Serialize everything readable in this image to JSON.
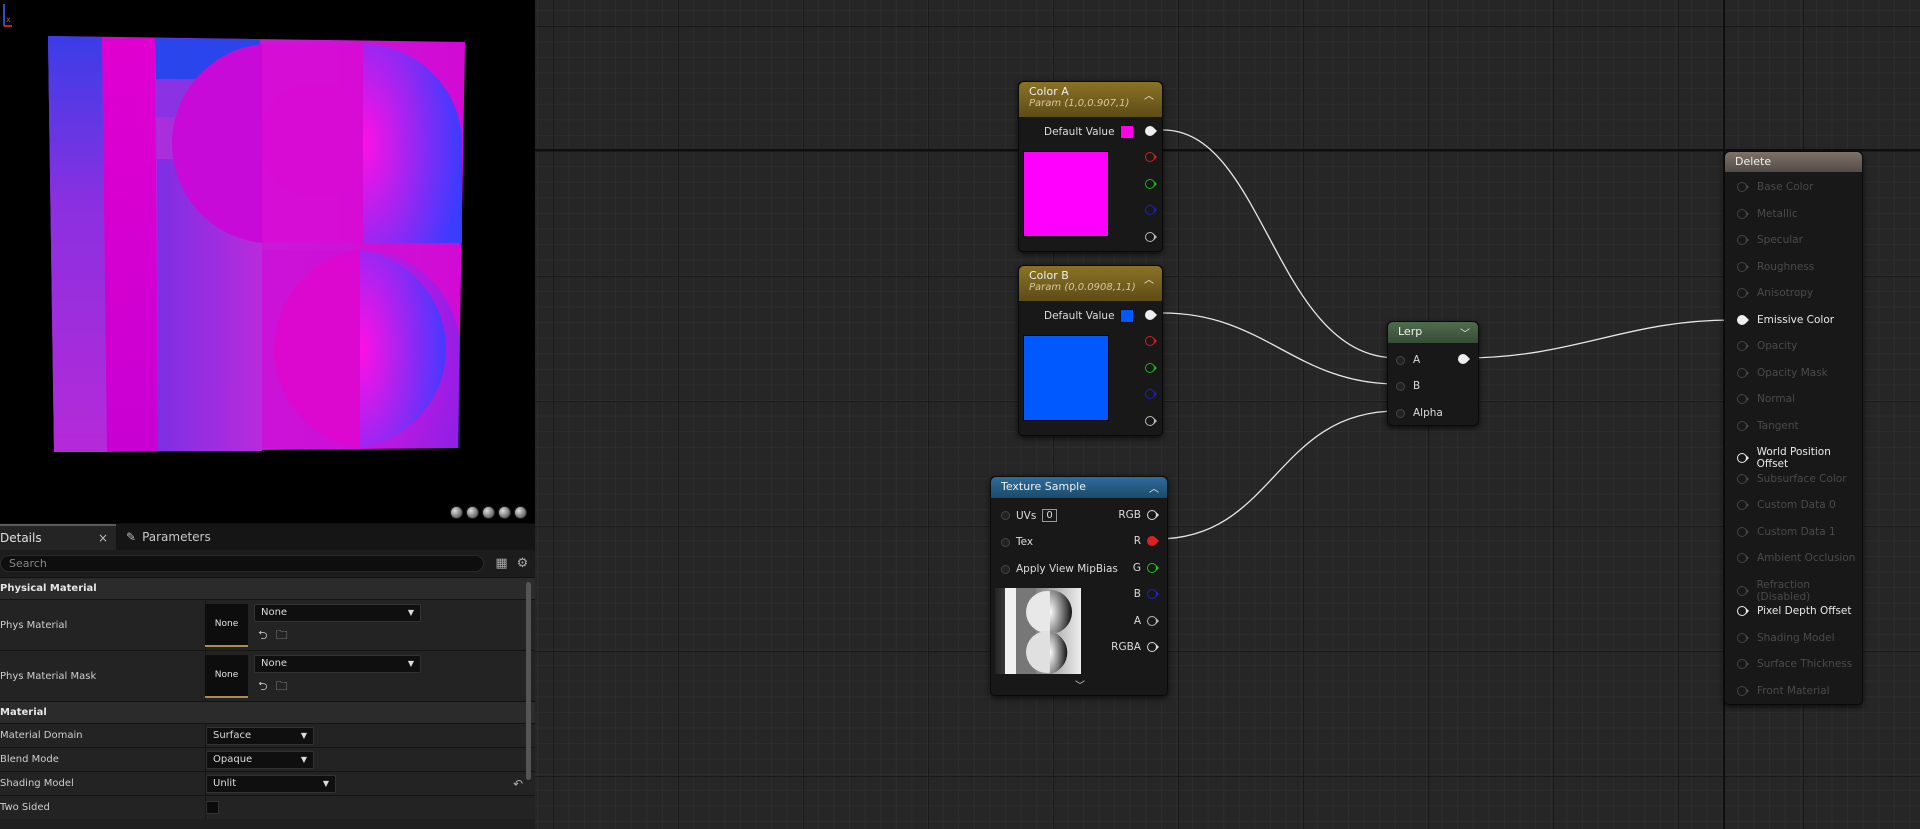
{
  "details": {
    "tabs": [
      {
        "label": "Details",
        "close": "×"
      },
      {
        "label": "Parameters"
      }
    ],
    "search_placeholder": "Search",
    "sections": {
      "physical_material": "Physical Material",
      "material": "Material"
    },
    "properties": {
      "phys_material": {
        "label": "Phys Material",
        "thumb": "None",
        "value": "None"
      },
      "phys_material_mask": {
        "label": "Phys Material Mask",
        "thumb": "None",
        "value": "None"
      },
      "material_domain": {
        "label": "Material Domain",
        "value": "Surface"
      },
      "blend_mode": {
        "label": "Blend Mode",
        "value": "Opaque"
      },
      "shading_model": {
        "label": "Shading Model",
        "value": "Unlit"
      },
      "two_sided": {
        "label": "Two Sided",
        "checked": false
      }
    }
  },
  "nodes": {
    "color_a": {
      "title": "Color A",
      "subtitle": "Param (1,0,0.907,1)",
      "default_label": "Default Value",
      "color": "#ff00e8"
    },
    "color_b": {
      "title": "Color B",
      "subtitle": "Param (0,0.0908,1,1)",
      "default_label": "Default Value",
      "color": "#0058ff"
    },
    "texture_sample": {
      "title": "Texture Sample",
      "inputs": [
        "UVs",
        "Tex",
        "Apply View MipBias"
      ],
      "uv_index": "0",
      "outputs": [
        "RGB",
        "R",
        "G",
        "B",
        "A",
        "RGBA"
      ]
    },
    "lerp": {
      "title": "Lerp",
      "inputs": [
        "A",
        "B",
        "Alpha"
      ]
    },
    "result": {
      "title": "Delete",
      "pins": [
        {
          "label": "Base Color",
          "active": false
        },
        {
          "label": "Metallic",
          "active": false
        },
        {
          "label": "Specular",
          "active": false
        },
        {
          "label": "Roughness",
          "active": false
        },
        {
          "label": "Anisotropy",
          "active": false
        },
        {
          "label": "Emissive Color",
          "active": true
        },
        {
          "label": "Opacity",
          "active": false
        },
        {
          "label": "Opacity Mask",
          "active": false
        },
        {
          "label": "Normal",
          "active": false
        },
        {
          "label": "Tangent",
          "active": false
        },
        {
          "label": "World Position Offset",
          "active": true
        },
        {
          "label": "Subsurface Color",
          "active": false
        },
        {
          "label": "Custom Data 0",
          "active": false
        },
        {
          "label": "Custom Data 1",
          "active": false
        },
        {
          "label": "Ambient Occlusion",
          "active": false
        },
        {
          "label": "Refraction (Disabled)",
          "active": false
        },
        {
          "label": "Pixel Depth Offset",
          "active": true
        },
        {
          "label": "Shading Model",
          "active": false
        },
        {
          "label": "Surface Thickness",
          "active": false
        },
        {
          "label": "Front Material",
          "active": false
        }
      ]
    }
  },
  "colors": {
    "accent_param": "#8a7326",
    "accent_texture": "#2e6d9a",
    "accent_lerp": "#4f6b4d",
    "magenta": "#ff00e8",
    "blue": "#0058ff"
  }
}
